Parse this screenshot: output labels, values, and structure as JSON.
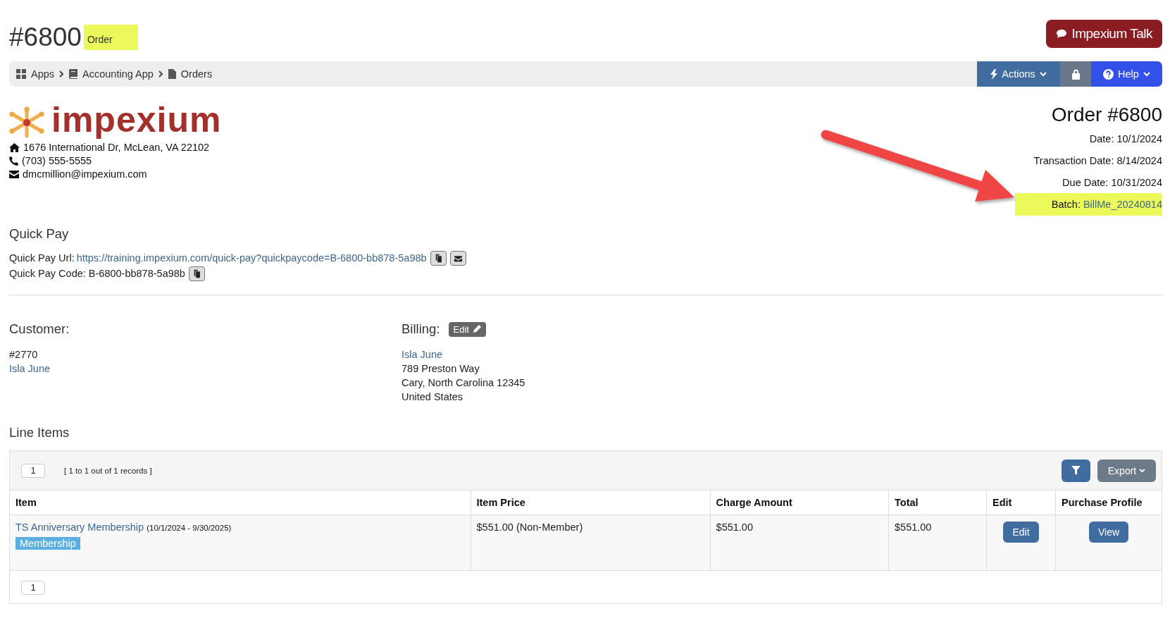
{
  "page_title": {
    "number": "#6800",
    "subtitle": "Order",
    "subtitle_highlighted": true
  },
  "talk_button": {
    "label": "Impexium Talk"
  },
  "breadcrumb": [
    {
      "label": "Apps"
    },
    {
      "label": "Accounting App"
    },
    {
      "label": "Orders"
    }
  ],
  "toolbar": {
    "actions_label": "Actions",
    "help_label": "Help"
  },
  "company": {
    "logo_text": "impexium",
    "address": "1676 International Dr, McLean, VA 22102",
    "phone": "(703) 555-5555",
    "email": "dmcmillion@impexium.com"
  },
  "order_info": {
    "title": "Order #6800",
    "fields": [
      {
        "label": "Date:",
        "value": "10/1/2024",
        "highlighted": false
      },
      {
        "label": "Transaction Date:",
        "value": "8/14/2024",
        "highlighted": false
      },
      {
        "label": "Due Date:",
        "value": "10/31/2024",
        "highlighted": false
      },
      {
        "label": "Batch:",
        "value": "BillMe_20240814",
        "highlighted": true
      }
    ]
  },
  "annotation_arrow": true,
  "quick_pay": {
    "heading": "Quick Pay",
    "url_label": "Quick Pay Url:",
    "url": "https://training.impexium.com/quick-pay?quickpaycode=B-6800-bb878-5a98b",
    "code_label": "Quick Pay Code:",
    "code": "B-6800-bb878-5a98b"
  },
  "customer": {
    "heading": "Customer:",
    "number": "#2770",
    "name": "Isla June"
  },
  "billing": {
    "heading": "Billing:",
    "edit_label": "Edit",
    "name": "Isla June",
    "address_lines": [
      "789 Preston Way",
      "Cary, North Carolina 12345",
      "United States"
    ]
  },
  "line_items": {
    "heading": "Line Items",
    "page": "1",
    "records": "[ 1 to 1 out of 1 records ]",
    "export_label": "Export",
    "columns": [
      "Item",
      "Item Price",
      "Charge Amount",
      "Total",
      "Edit",
      "Purchase Profile"
    ],
    "rows": [
      {
        "item": "TS Anniversary Membership",
        "period": "(10/1/2024 - 9/30/2025)",
        "tag": "Membership",
        "item_price": "$551.00 (Non-Member)",
        "charge_amount": "$551.00",
        "total": "$551.00",
        "edit_label": "Edit",
        "profile_label": "View"
      }
    ],
    "footer_page": "1"
  }
}
